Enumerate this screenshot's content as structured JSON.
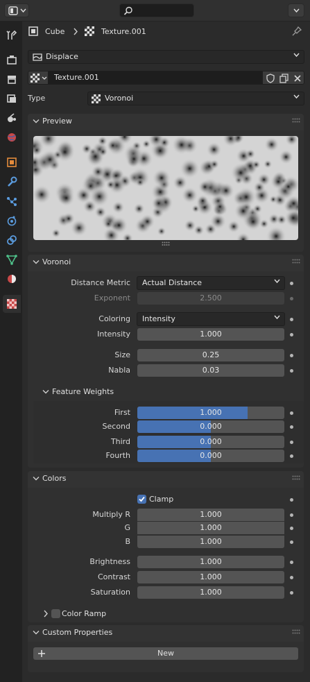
{
  "breadcrumb": {
    "object": "Cube",
    "texture": "Texture.001"
  },
  "modifier": {
    "name": "Displace"
  },
  "texture_slot": {
    "name": "Texture.001"
  },
  "type": {
    "label": "Type",
    "value": "Voronoi"
  },
  "preview": {
    "title": "Preview"
  },
  "voronoi": {
    "title": "Voronoi",
    "distance_metric": {
      "label": "Distance Metric",
      "value": "Actual Distance"
    },
    "exponent": {
      "label": "Exponent",
      "value": "2.500"
    },
    "coloring": {
      "label": "Coloring",
      "value": "Intensity"
    },
    "intensity": {
      "label": "Intensity",
      "value": "1.000"
    },
    "size": {
      "label": "Size",
      "value": "0.25"
    },
    "nabla": {
      "label": "Nabla",
      "value": "0.03"
    },
    "feature_weights": {
      "title": "Feature Weights",
      "items": [
        {
          "label": "First",
          "value": "1.000",
          "fill": 0.75
        },
        {
          "label": "Second",
          "value": "0.000",
          "fill": 0.5
        },
        {
          "label": "Third",
          "value": "0.000",
          "fill": 0.5
        },
        {
          "label": "Fourth",
          "value": "0.000",
          "fill": 0.5
        }
      ]
    }
  },
  "colors": {
    "title": "Colors",
    "clamp": {
      "label": "Clamp",
      "checked": true
    },
    "multiply_r": {
      "label": "Multiply R",
      "value": "1.000"
    },
    "g": {
      "label": "G",
      "value": "1.000"
    },
    "b": {
      "label": "B",
      "value": "1.000"
    },
    "brightness": {
      "label": "Brightness",
      "value": "1.000"
    },
    "contrast": {
      "label": "Contrast",
      "value": "1.000"
    },
    "saturation": {
      "label": "Saturation",
      "value": "1.000"
    },
    "color_ramp": {
      "label": "Color Ramp",
      "checked": false
    }
  },
  "custom_properties": {
    "title": "Custom Properties",
    "new_label": "New"
  },
  "theme": {
    "accent": "#4772b3",
    "checkbox": "#4772b3"
  }
}
